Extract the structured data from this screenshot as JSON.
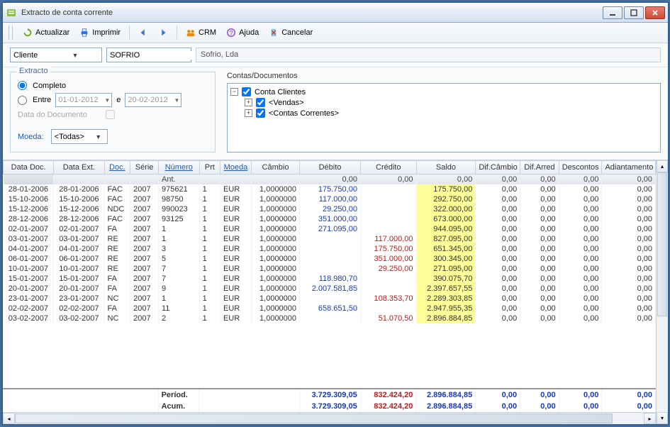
{
  "window": {
    "title": "Extracto de conta corrente"
  },
  "toolbar": {
    "actualizar": "Actualizar",
    "imprimir": "Imprimir",
    "crm": "CRM",
    "ajuda": "Ajuda",
    "cancelar": "Cancelar"
  },
  "filter": {
    "type_label": "Cliente",
    "code": "SOFRIO",
    "name": "Sofrio, Lda"
  },
  "extracto": {
    "legend": "Extracto",
    "completo": "Completo",
    "entre": "Entre",
    "e": "e",
    "date_from": "01-01-2012",
    "date_to": "20-02-2012",
    "data_doc": "Data do Documento",
    "moeda_label": "Moeda:",
    "moeda_value": "<Todas>"
  },
  "tree": {
    "label": "Contas/Documentos",
    "root": "Conta Clientes",
    "child1": "<Vendas>",
    "child2": "<Contas Correntes>"
  },
  "columns": {
    "data_doc": "Data Doc.",
    "data_ext": "Data Ext.",
    "doc": "Doc.",
    "serie": "Série",
    "numero": "Número",
    "prt": "Prt",
    "moeda": "Moeda",
    "cambio": "Câmbio",
    "debito": "Débito",
    "credito": "Crédito",
    "saldo": "Saldo",
    "dif_cambio": "Dif.Câmbio",
    "dif_arred": "Dif.Arred",
    "descontos": "Descontos",
    "adiantamento": "Adiantamento"
  },
  "ant_label": "Ant.",
  "ant": {
    "debito": "0,00",
    "credito": "0,00",
    "saldo": "0,00",
    "dc": "0,00",
    "da": "0,00",
    "desc": "0,00",
    "adi": "0,00"
  },
  "rows": [
    {
      "dd": "28-01-2006",
      "de": "28-01-2006",
      "doc": "FAC",
      "ser": "2007",
      "num": "975621",
      "prt": "1",
      "m": "EUR",
      "cam": "1,0000000",
      "deb": "175.750,00",
      "cre": "",
      "sal": "175.750,00",
      "dc": "0,00",
      "da": "0,00",
      "des": "0,00",
      "adi": "0,00"
    },
    {
      "dd": "15-10-2006",
      "de": "15-10-2006",
      "doc": "FAC",
      "ser": "2007",
      "num": "98750",
      "prt": "1",
      "m": "EUR",
      "cam": "1,0000000",
      "deb": "117.000,00",
      "cre": "",
      "sal": "292.750,00",
      "dc": "0,00",
      "da": "0,00",
      "des": "0,00",
      "adi": "0,00"
    },
    {
      "dd": "15-12-2006",
      "de": "15-12-2006",
      "doc": "NDC",
      "ser": "2007",
      "num": "990023",
      "prt": "1",
      "m": "EUR",
      "cam": "1,0000000",
      "deb": "29.250,00",
      "cre": "",
      "sal": "322.000,00",
      "dc": "0,00",
      "da": "0,00",
      "des": "0,00",
      "adi": "0,00"
    },
    {
      "dd": "28-12-2006",
      "de": "28-12-2006",
      "doc": "FAC",
      "ser": "2007",
      "num": "93125",
      "prt": "1",
      "m": "EUR",
      "cam": "1,0000000",
      "deb": "351.000,00",
      "cre": "",
      "sal": "673.000,00",
      "dc": "0,00",
      "da": "0,00",
      "des": "0,00",
      "adi": "0,00"
    },
    {
      "dd": "02-01-2007",
      "de": "02-01-2007",
      "doc": "FA",
      "ser": "2007",
      "num": "1",
      "prt": "1",
      "m": "EUR",
      "cam": "1,0000000",
      "deb": "271.095,00",
      "cre": "",
      "sal": "944.095,00",
      "dc": "0,00",
      "da": "0,00",
      "des": "0,00",
      "adi": "0,00"
    },
    {
      "dd": "03-01-2007",
      "de": "03-01-2007",
      "doc": "RE",
      "ser": "2007",
      "num": "1",
      "prt": "1",
      "m": "EUR",
      "cam": "1,0000000",
      "deb": "",
      "cre": "117.000,00",
      "sal": "827.095,00",
      "dc": "0,00",
      "da": "0,00",
      "des": "0,00",
      "adi": "0,00"
    },
    {
      "dd": "04-01-2007",
      "de": "04-01-2007",
      "doc": "RE",
      "ser": "2007",
      "num": "3",
      "prt": "1",
      "m": "EUR",
      "cam": "1,0000000",
      "deb": "",
      "cre": "175.750,00",
      "sal": "651.345,00",
      "dc": "0,00",
      "da": "0,00",
      "des": "0,00",
      "adi": "0,00"
    },
    {
      "dd": "06-01-2007",
      "de": "06-01-2007",
      "doc": "RE",
      "ser": "2007",
      "num": "5",
      "prt": "1",
      "m": "EUR",
      "cam": "1,0000000",
      "deb": "",
      "cre": "351.000,00",
      "sal": "300.345,00",
      "dc": "0,00",
      "da": "0,00",
      "des": "0,00",
      "adi": "0,00"
    },
    {
      "dd": "10-01-2007",
      "de": "10-01-2007",
      "doc": "RE",
      "ser": "2007",
      "num": "7",
      "prt": "1",
      "m": "EUR",
      "cam": "1,0000000",
      "deb": "",
      "cre": "29.250,00",
      "sal": "271.095,00",
      "dc": "0,00",
      "da": "0,00",
      "des": "0,00",
      "adi": "0,00"
    },
    {
      "dd": "15-01-2007",
      "de": "15-01-2007",
      "doc": "FA",
      "ser": "2007",
      "num": "7",
      "prt": "1",
      "m": "EUR",
      "cam": "1,0000000",
      "deb": "118.980,70",
      "cre": "",
      "sal": "390.075,70",
      "dc": "0,00",
      "da": "0,00",
      "des": "0,00",
      "adi": "0,00"
    },
    {
      "dd": "20-01-2007",
      "de": "20-01-2007",
      "doc": "FA",
      "ser": "2007",
      "num": "9",
      "prt": "1",
      "m": "EUR",
      "cam": "1,0000000",
      "deb": "2.007.581,85",
      "cre": "",
      "sal": "2.397.657,55",
      "dc": "0,00",
      "da": "0,00",
      "des": "0,00",
      "adi": "0,00"
    },
    {
      "dd": "23-01-2007",
      "de": "23-01-2007",
      "doc": "NC",
      "ser": "2007",
      "num": "1",
      "prt": "1",
      "m": "EUR",
      "cam": "1,0000000",
      "deb": "",
      "cre": "108.353,70",
      "sal": "2.289.303,85",
      "dc": "0,00",
      "da": "0,00",
      "des": "0,00",
      "adi": "0,00"
    },
    {
      "dd": "02-02-2007",
      "de": "02-02-2007",
      "doc": "FA",
      "ser": "2007",
      "num": "11",
      "prt": "1",
      "m": "EUR",
      "cam": "1,0000000",
      "deb": "658.651,50",
      "cre": "",
      "sal": "2.947.955,35",
      "dc": "0,00",
      "da": "0,00",
      "des": "0,00",
      "adi": "0,00"
    },
    {
      "dd": "03-02-2007",
      "de": "03-02-2007",
      "doc": "NC",
      "ser": "2007",
      "num": "2",
      "prt": "1",
      "m": "EUR",
      "cam": "1,0000000",
      "deb": "",
      "cre": "51.070,50",
      "sal": "2.896.884,85",
      "dc": "0,00",
      "da": "0,00",
      "des": "0,00",
      "adi": "0,00"
    }
  ],
  "summary": {
    "period_label": "Períod.",
    "acum_label": "Acum.",
    "period": {
      "deb": "3.729.309,05",
      "cre": "832.424,20",
      "sal": "2.896.884,85",
      "dc": "0,00",
      "da": "0,00",
      "des": "0,00",
      "adi": "0,00"
    },
    "acum": {
      "deb": "3.729.309,05",
      "cre": "832.424,20",
      "sal": "2.896.884,85",
      "dc": "0,00",
      "da": "0,00",
      "des": "0,00",
      "adi": "0,00"
    }
  }
}
